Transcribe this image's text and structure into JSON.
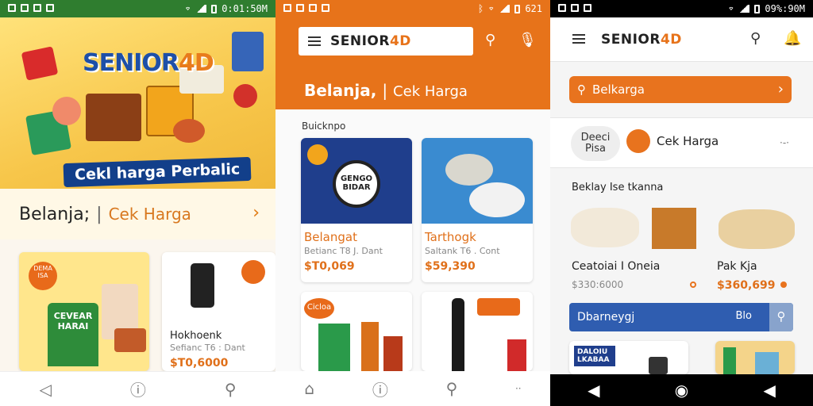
{
  "status_bar": {
    "p1_time": "0:01:50M",
    "p2_time": "621",
    "p3_time": "09%:90M"
  },
  "phone1": {
    "brand_prefix": "SENIOR",
    "brand_suffix": "4D",
    "banner": "Cekl harga Perbalic",
    "belanja": "Belanja;",
    "separator": "|",
    "cek_harga": "Cek Harga",
    "card1_badge": "DEMA ISA",
    "card1_text": "CEVEAR HARAI",
    "card2_title": "Hokhoenk",
    "card2_sub": "Sefianc T6 : Dant",
    "card2_price": "$T0,6000"
  },
  "phone2": {
    "logo_prefix": "SENIOR",
    "logo_suffix": "4D",
    "sub_belanja": "Belanja,",
    "sub_sep": "|",
    "sub_cek": "Cek Harga",
    "section": "Buicknpo",
    "card1_poster": "GENGO BIDAR",
    "card1_title": "Belangat",
    "card1_sub": "Betianc T8 J. Dant",
    "card1_price": "$T0,069",
    "card2_title": "Tarthogk",
    "card2_sub": "Saltank T6 . Cont",
    "card2_price": "$59,390",
    "card3_badge": "Cicloa",
    "card4_badge": ""
  },
  "phone3": {
    "logo_prefix": "SENIOR",
    "logo_suffix": "4D",
    "search": "Belkarga",
    "chip": "Deeci Pisa",
    "cek_harga": "Cek Harga",
    "more": "·-·",
    "section": "Beklay Ise tkanna",
    "item1_title": "Ceatoiai I Oneia",
    "item1_price": "$330:6000",
    "item2_title": "Pak Kja",
    "item2_price": "$360,699",
    "bluebar": "Dbarneygj",
    "bluebar_right": "Blo",
    "card_badge": "DALOIU LKABAA"
  },
  "colors": {
    "orange": "#e7731a",
    "blue": "#1e4fa8",
    "green": "#2f7d2f"
  }
}
